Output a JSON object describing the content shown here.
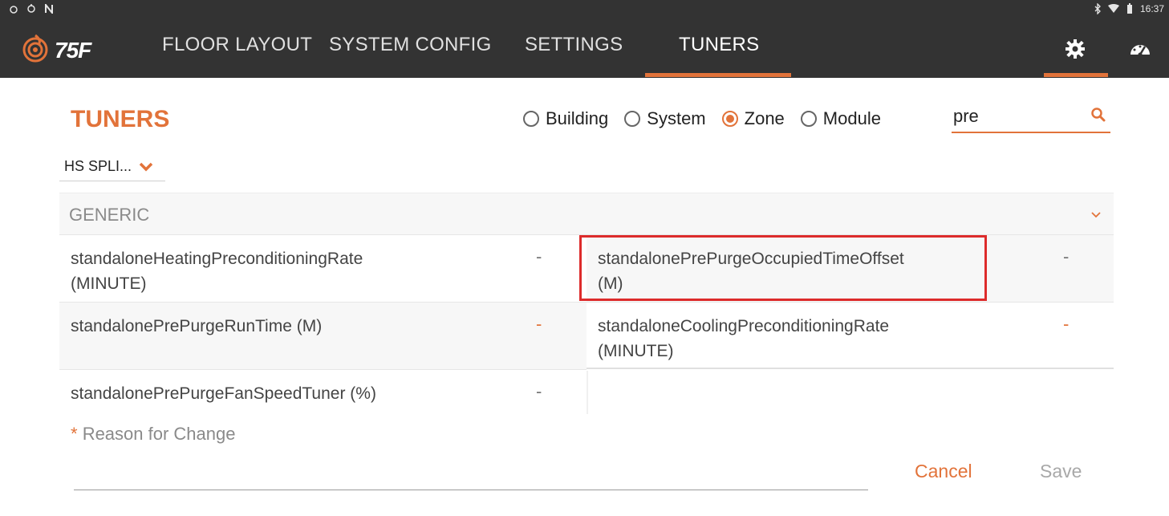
{
  "status_bar": {
    "left_icons": [
      "circle-icon",
      "sync-icon",
      "n-icon"
    ],
    "right_icons": [
      "bluetooth-icon",
      "wifi-icon",
      "battery-icon"
    ],
    "time": "16:37"
  },
  "app": {
    "logo_text": "75F",
    "accent_color": "#e2733a",
    "nav_tabs": [
      {
        "label": "FLOOR LAYOUT",
        "active": false
      },
      {
        "label": "SYSTEM CONFIG",
        "active": false
      },
      {
        "label": "SETTINGS",
        "active": false
      },
      {
        "label": "TUNERS",
        "active": true
      }
    ],
    "top_icons": [
      "gear-icon",
      "dashboard-icon"
    ]
  },
  "page": {
    "title": "TUNERS",
    "scope_options": [
      {
        "label": "Building",
        "checked": false
      },
      {
        "label": "System",
        "checked": false
      },
      {
        "label": "Zone",
        "checked": true
      },
      {
        "label": "Module",
        "checked": false
      }
    ],
    "search": {
      "value": "pre",
      "placeholder": ""
    },
    "zone_dropdown": {
      "selected": "HS SPLI..."
    },
    "section": {
      "title": "GENERIC",
      "expanded": true
    },
    "tuners": [
      {
        "name": "standaloneHeatingPreconditioningRate",
        "unit": "(MINUTE)",
        "value": "-"
      },
      {
        "name": "standalonePrePurgeOccupiedTimeOffset",
        "unit": "(M)",
        "value": "-"
      },
      {
        "name": "standalonePrePurgeRunTime (M)",
        "unit": "",
        "value": "-"
      },
      {
        "name": "standaloneCoolingPreconditioningRate",
        "unit": "(MINUTE)",
        "value": "-"
      },
      {
        "name": "standalonePrePurgeFanSpeedTuner (%)",
        "unit": "",
        "value": "-"
      }
    ],
    "reason": {
      "asterisk": "*",
      "label": "Reason for Change",
      "value": ""
    },
    "buttons": {
      "cancel": "Cancel",
      "save": "Save"
    }
  }
}
